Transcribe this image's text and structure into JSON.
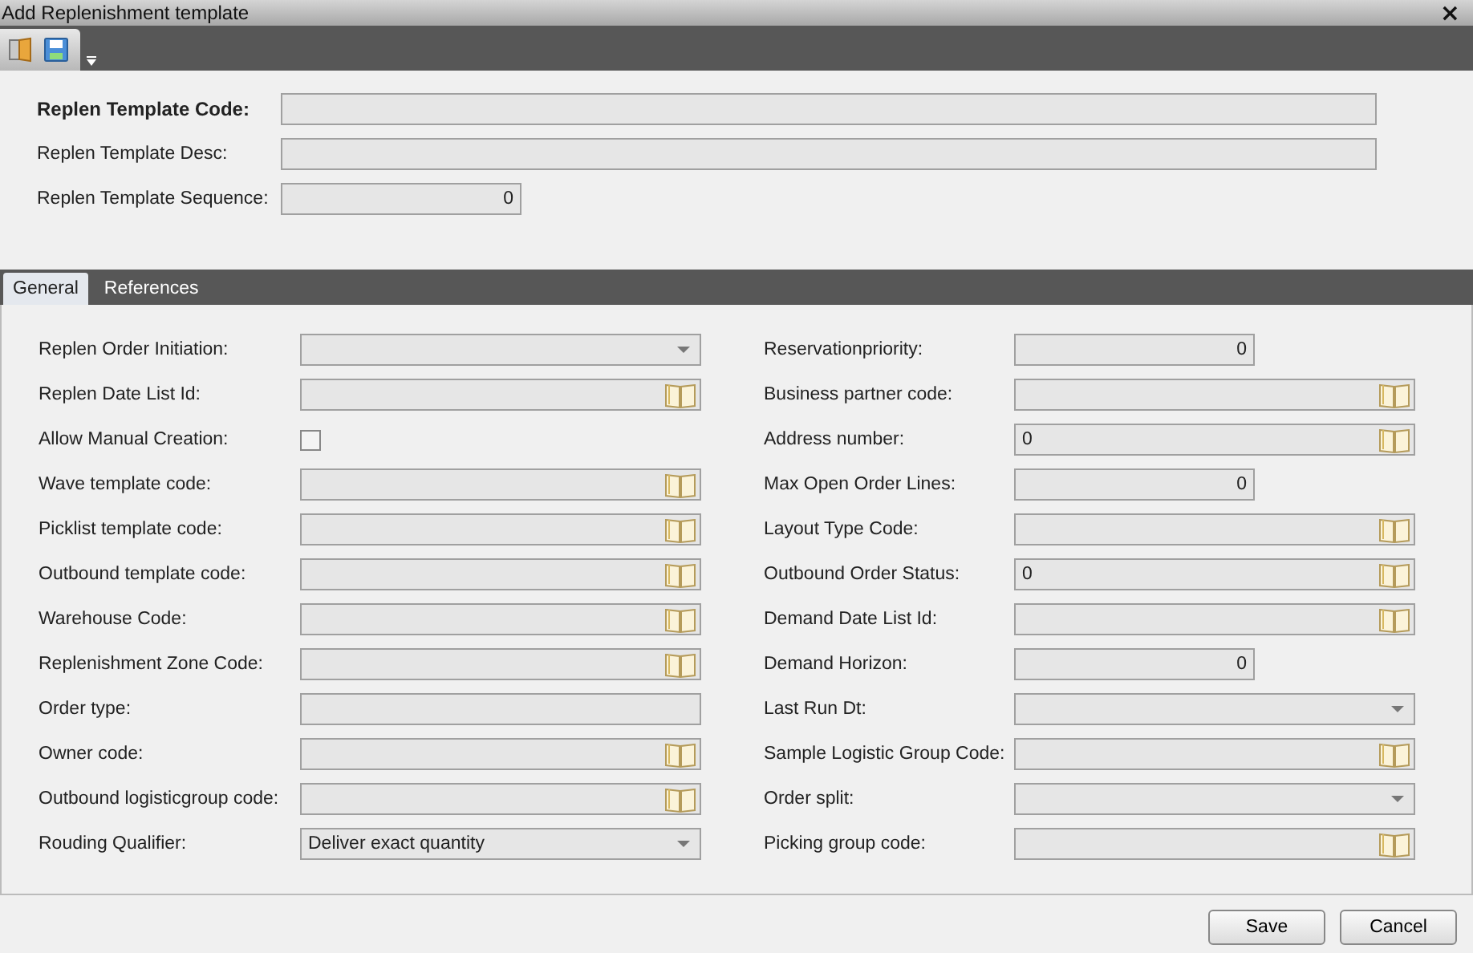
{
  "window": {
    "title": "Add Replenishment template",
    "close": "×"
  },
  "header_fields": [
    {
      "label": "Replen Template Code:",
      "bold": true,
      "kind": "text"
    },
    {
      "label": "Replen Template Desc:",
      "bold": false,
      "kind": "text"
    },
    {
      "label": "Replen Template Sequence:",
      "bold": false,
      "kind": "number",
      "value": "0"
    }
  ],
  "tabs": [
    {
      "label": "General",
      "selected": true
    },
    {
      "label": "References",
      "selected": false
    }
  ],
  "left_fields": [
    {
      "label": "Replen Order Initiation:",
      "kind": "dropdown"
    },
    {
      "label": "Replen Date List Id:",
      "kind": "lookup"
    },
    {
      "label": "Allow Manual Creation:",
      "kind": "checkbox",
      "checked": false
    },
    {
      "label": "Wave template code:",
      "kind": "lookup"
    },
    {
      "label": "Picklist template code:",
      "kind": "lookup"
    },
    {
      "label": "Outbound template code:",
      "kind": "lookup"
    },
    {
      "label": "Warehouse Code:",
      "kind": "lookup"
    },
    {
      "label": "Replenishment Zone Code:",
      "kind": "lookup"
    },
    {
      "label": "Order type:",
      "kind": "text"
    },
    {
      "label": "Owner code:",
      "kind": "lookup"
    },
    {
      "label": "Outbound logisticgroup code:",
      "kind": "lookup"
    },
    {
      "label": "Rouding Qualifier:",
      "kind": "dropdown",
      "value": "Deliver exact quantity"
    }
  ],
  "right_fields": [
    {
      "label": "Reservationpriority:",
      "kind": "number",
      "value": "0"
    },
    {
      "label": "Business partner code:",
      "kind": "lookup"
    },
    {
      "label": "Address number:",
      "kind": "lookup",
      "value": "0"
    },
    {
      "label": "Max Open Order Lines:",
      "kind": "number",
      "value": "0"
    },
    {
      "label": "Layout Type Code:",
      "kind": "lookup"
    },
    {
      "label": "Outbound Order Status:",
      "kind": "lookup",
      "value": "0"
    },
    {
      "label": "Demand Date List Id:",
      "kind": "lookup"
    },
    {
      "label": "Demand Horizon:",
      "kind": "number",
      "value": "0"
    },
    {
      "label": "Last Run Dt:",
      "kind": "dropdown"
    },
    {
      "label": "Sample Logistic Group Code:",
      "kind": "lookup"
    },
    {
      "label": "Order split:",
      "kind": "dropdown"
    },
    {
      "label": "Picking group code:",
      "kind": "lookup"
    }
  ],
  "buttons": [
    "Save",
    "Cancel"
  ]
}
